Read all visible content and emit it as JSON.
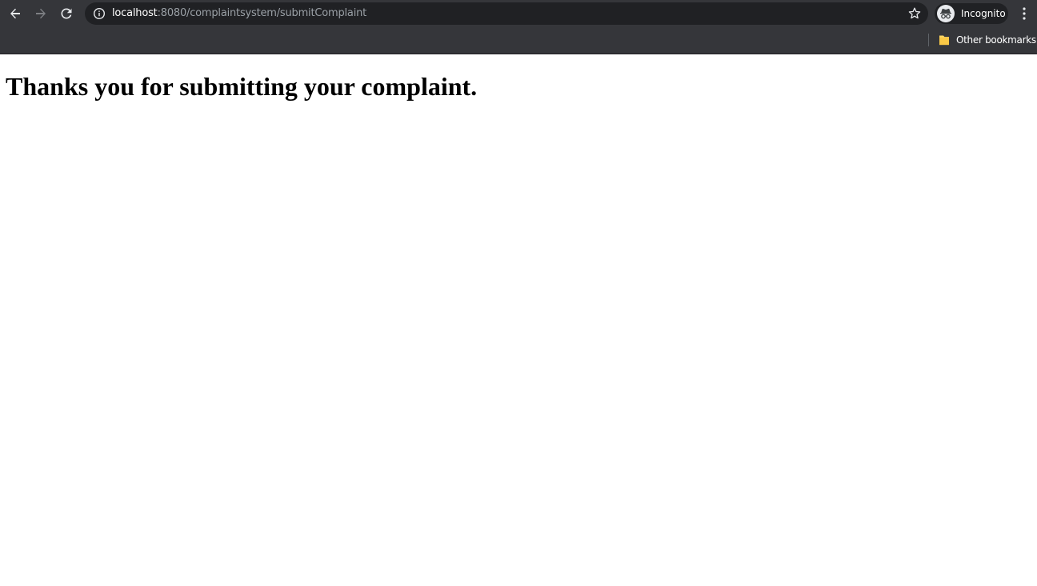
{
  "browser": {
    "url_host": "localhost",
    "url_rest": ":8080/complaintsystem/submitComplaint",
    "profile_label": "Incognito",
    "bookmarks": {
      "other_label": "Other bookmarks"
    },
    "icons": {
      "back": "back-arrow-icon",
      "forward": "forward-arrow-icon",
      "reload": "reload-icon",
      "site_info": "info-icon",
      "bookmark_star": "star-icon",
      "profile": "incognito-icon",
      "menu": "kebab-menu-icon",
      "folder": "folder-icon"
    },
    "colors": {
      "chrome_bg": "#35363a",
      "omnibox_bg": "#202124",
      "folder": "#fdd663"
    }
  },
  "page": {
    "heading": "Thanks you for submitting your complaint."
  }
}
